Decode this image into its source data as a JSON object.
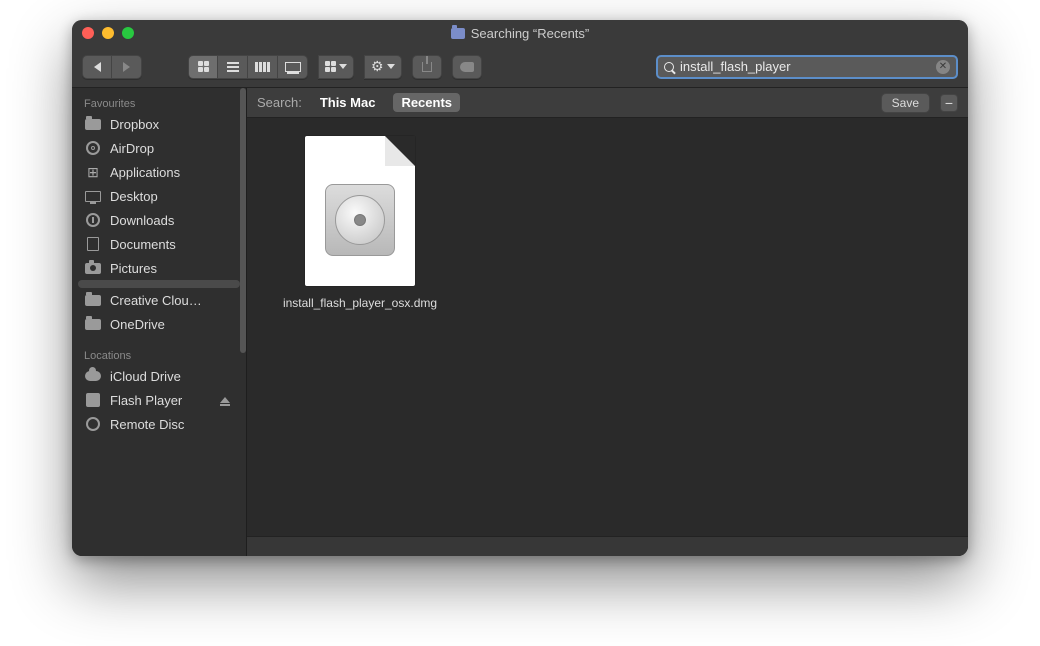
{
  "window": {
    "title": "Searching “Recents”"
  },
  "search": {
    "value": "install_flash_player"
  },
  "scope": {
    "label": "Search:",
    "this_mac": "This Mac",
    "recents": "Recents",
    "save": "Save"
  },
  "sidebar": {
    "section_favourites": "Favourites",
    "section_locations": "Locations",
    "items": [
      {
        "label": "Dropbox"
      },
      {
        "label": "AirDrop"
      },
      {
        "label": "Applications"
      },
      {
        "label": "Desktop"
      },
      {
        "label": "Downloads"
      },
      {
        "label": "Documents"
      },
      {
        "label": "Pictures"
      },
      {
        "label": ""
      },
      {
        "label": "Creative Clou…"
      },
      {
        "label": "OneDrive"
      }
    ],
    "locations": [
      {
        "label": "iCloud Drive"
      },
      {
        "label": "Flash Player"
      },
      {
        "label": "Remote Disc"
      }
    ]
  },
  "results": {
    "files": [
      {
        "name": "install_flash_player_osx.dmg"
      }
    ]
  }
}
